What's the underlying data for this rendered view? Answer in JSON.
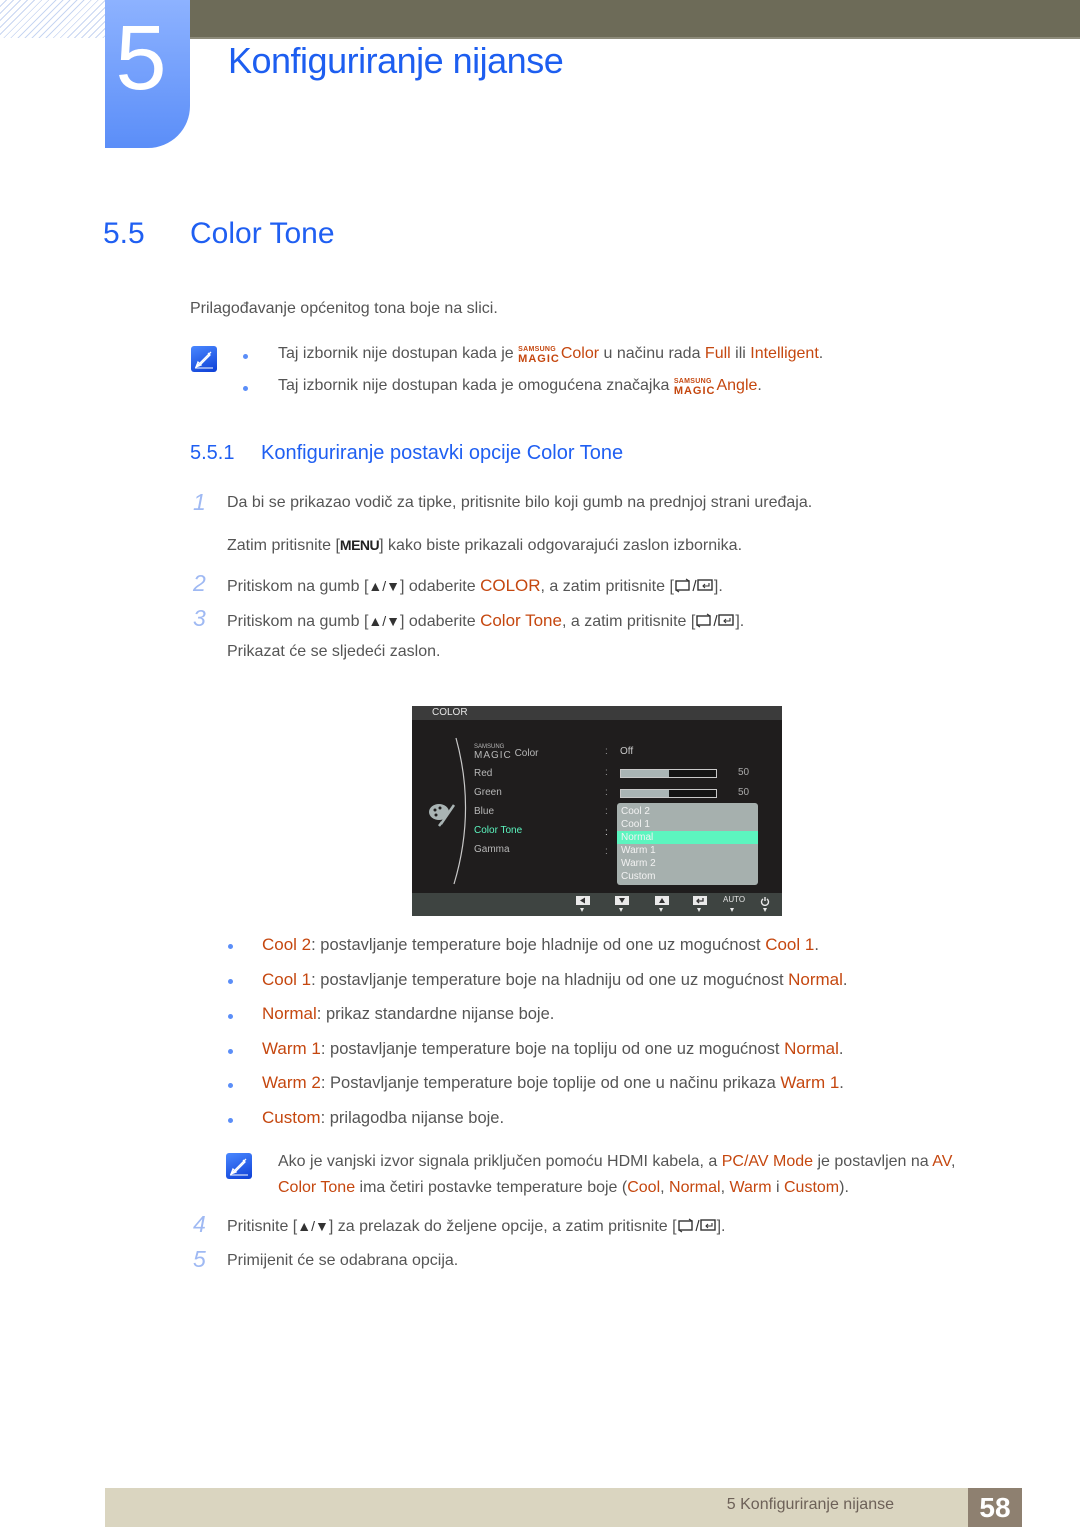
{
  "chapter": {
    "number": "5",
    "title": "Konfiguriranje nijanse"
  },
  "section": {
    "number": "5.5",
    "title": "Color Tone",
    "intro": "Prilagođavanje općenitog tona boje na slici."
  },
  "notes_top": [
    {
      "pre": "Taj izbornik nije dostupan kada je ",
      "brand_small": "SAMSUNG",
      "brand_big": "MAGIC",
      "brand_word": "Color",
      "mid": " u načinu rada ",
      "hl1": "Full",
      "mid2": " ili ",
      "hl2": "Intelligent",
      "post": "."
    },
    {
      "pre": "Taj izbornik nije dostupan kada je omogućena značajka ",
      "brand_small": "SAMSUNG",
      "brand_big": "MAGIC",
      "brand_word": "Angle",
      "post": "."
    }
  ],
  "subsection": {
    "number": "5.5.1",
    "title": "Konfiguriranje postavki opcije Color Tone"
  },
  "steps": {
    "s1": {
      "num": "1",
      "text": "Da bi se prikazao vodič za tipke, pritisnite bilo koji gumb na prednjoj strani uređaja."
    },
    "s1b": {
      "pre": "Zatim pritisnite [",
      "key": "MENU",
      "post": "] kako biste prikazali odgovarajući zaslon izbornika."
    },
    "s2": {
      "num": "2",
      "pre": "Pritiskom na gumb [",
      "keys": "▲/▼",
      "mid": "] odaberite ",
      "hl": "COLOR",
      "post": ", a zatim pritisnite [",
      "end": "]."
    },
    "s3": {
      "num": "3",
      "pre": "Pritiskom na gumb [",
      "keys": "▲/▼",
      "mid": "] odaberite ",
      "hl": "Color Tone",
      "post": ", a zatim pritisnite [",
      "end": "]."
    },
    "s3b": {
      "text": "Prikazat će se sljedeći zaslon."
    },
    "s4": {
      "num": "4",
      "pre": "Pritisnite [",
      "keys": "▲/▼",
      "mid": "] za prelazak do željene opcije, a zatim pritisnite [",
      "end": "]."
    },
    "s5": {
      "num": "5",
      "text": "Primijenit će se odabrana opcija."
    }
  },
  "osd": {
    "header": "COLOR",
    "menu": [
      {
        "label_small": "SAMSUNG",
        "label_big": "MAGIC",
        "label": "Color",
        "value": "Off"
      },
      {
        "label": "Red",
        "value_pct": 50,
        "value": "50"
      },
      {
        "label": "Green",
        "value_pct": 50,
        "value": "50"
      },
      {
        "label": "Blue"
      },
      {
        "label": "Color Tone",
        "active": true
      },
      {
        "label": "Gamma"
      }
    ],
    "colon": ":",
    "dropdown": [
      "Cool 2",
      "Cool 1",
      "Normal",
      "Warm 1",
      "Warm 2",
      "Custom"
    ],
    "dropdown_selected": "Normal",
    "footer_buttons": [
      "left-icon",
      "down-icon",
      "up-icon",
      "enter-icon",
      "AUTO",
      "power-icon"
    ],
    "active_color": "#5cf5bf"
  },
  "options": [
    {
      "name": "Cool 2",
      "desc": ": postavljanje temperature boje hladnije od one uz mogućnost ",
      "ref": "Cool 1",
      "end": "."
    },
    {
      "name": "Cool 1",
      "desc": ": postavljanje temperature boje na hladniju od one uz mogućnost ",
      "ref": "Normal",
      "end": "."
    },
    {
      "name": "Normal",
      "desc": ": prikaz standardne nijanse boje.",
      "ref": "",
      "end": ""
    },
    {
      "name": "Warm 1",
      "desc": ": postavljanje temperature boje na topliju od one uz mogućnost ",
      "ref": "Normal",
      "end": "."
    },
    {
      "name": "Warm 2",
      "desc": ": Postavljanje temperature boje toplije od one u načinu prikaza ",
      "ref": "Warm 1",
      "end": "."
    },
    {
      "name": "Custom",
      "desc": ": prilagodba nijanse boje.",
      "ref": "",
      "end": ""
    }
  ],
  "note_bottom": {
    "l1_pre": "Ako je vanjski izvor signala priključen pomoću HDMI kabela, a ",
    "l1_hl": "PC/AV Mode",
    "l1_mid": " je postavljen na ",
    "l1_hl2": "AV",
    "l1_end": ",",
    "l2_hl": "Color Tone",
    "l2_mid": " ima četiri postavke temperature boje (",
    "l2_a": "Cool",
    "l2_sep1": ", ",
    "l2_b": "Normal",
    "l2_sep2": ", ",
    "l2_c": "Warm",
    "l2_sep3": " i ",
    "l2_d": "Custom",
    "l2_end": ")."
  },
  "footer": {
    "chapter_label": "5 Konfiguriranje nijanse",
    "page": "58"
  },
  "colors": {
    "heading_blue": "#1f5ff2",
    "highlight_orange": "#c5470f",
    "footer_bg": "#dad5c0",
    "page_box": "#8e8070"
  }
}
